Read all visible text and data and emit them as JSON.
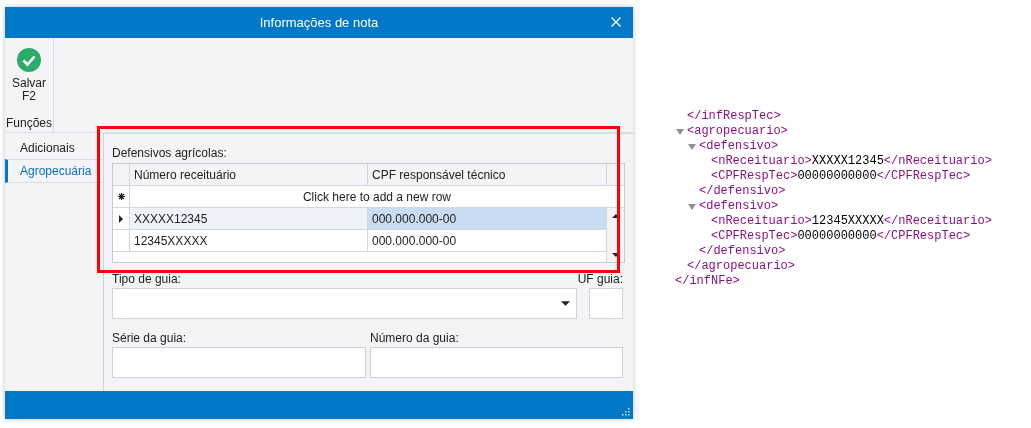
{
  "window": {
    "title": "Informações de nota"
  },
  "ribbon": {
    "buttons": [
      {
        "label": "Salvar",
        "shortcut": "F2"
      }
    ],
    "group_label": "Funções"
  },
  "tabs": [
    {
      "label": "Adicionais",
      "selected": false
    },
    {
      "label": "Agropecuária",
      "selected": true
    }
  ],
  "section_label": "Defensivos agrícolas:",
  "grid": {
    "columns": [
      "Número receituário",
      "CPF responsável técnico"
    ],
    "new_row_text": "Click here to add a new row",
    "rows": [
      {
        "cells": [
          "XXXXX12345",
          "000.000.000-00"
        ],
        "selected": true
      },
      {
        "cells": [
          "12345XXXXX",
          "000.000.000-00"
        ],
        "selected": false
      }
    ]
  },
  "fields": [
    {
      "label": "Tipo de guia:",
      "kind": "combobox"
    },
    {
      "label": "UF guia:",
      "kind": "text"
    },
    {
      "label": "Série da guia:",
      "kind": "text"
    },
    {
      "label": "Número da guia:",
      "kind": "text"
    }
  ],
  "xml_view": {
    "children": [
      {
        "close": "</infRespTec>"
      },
      {
        "open": "<agropecuario>",
        "expanded": true,
        "close": "</agropecuario>",
        "children": [
          {
            "open": "<defensivo>",
            "expanded": true,
            "close": "</defensivo>",
            "children": [
              {
                "open": "<nReceituario>",
                "value": "XXXXX12345",
                "close": "</nReceituario>"
              },
              {
                "open": "<CPFRespTec>",
                "value": "00000000000",
                "close": "</CPFRespTec>"
              }
            ]
          },
          {
            "open": "<defensivo>",
            "expanded": true,
            "close": "</defensivo>",
            "children": [
              {
                "open": "<nReceituario>",
                "value": "12345XXXXX",
                "close": "</nReceituario>"
              },
              {
                "open": "<CPFRespTec>",
                "value": "00000000000",
                "close": "</CPFRespTec>"
              }
            ]
          }
        ]
      }
    ],
    "close": "</infNFe>"
  }
}
